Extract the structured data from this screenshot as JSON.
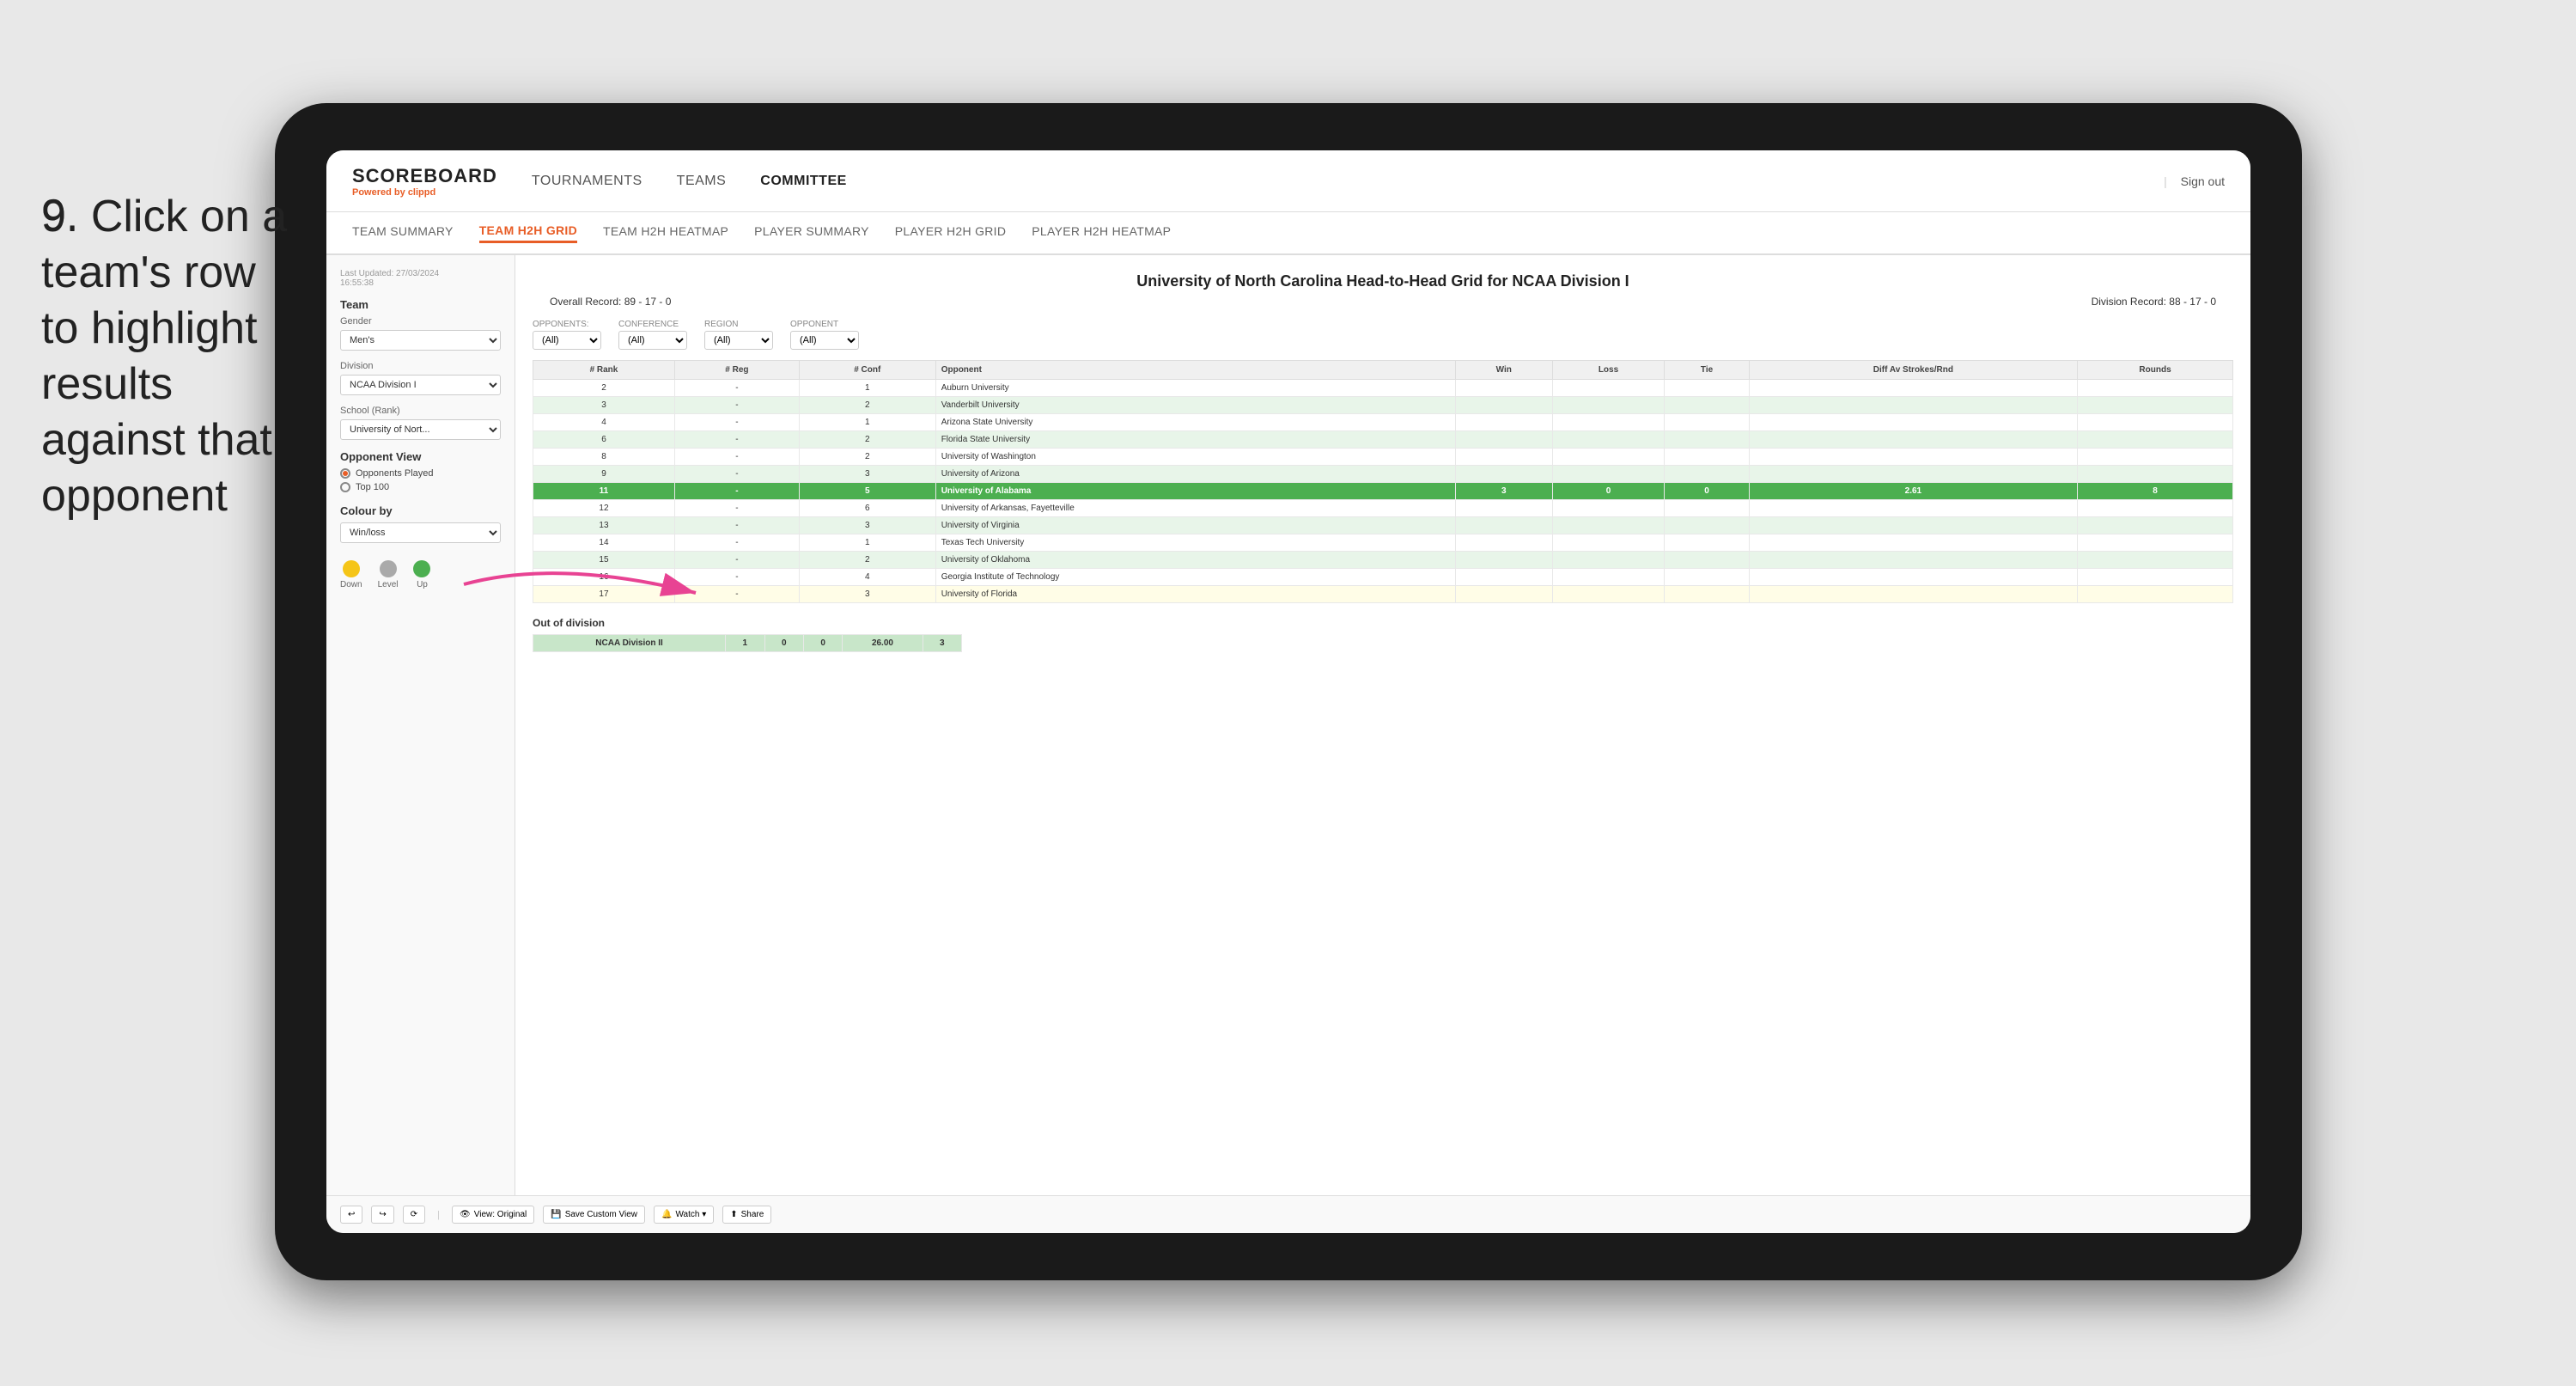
{
  "instruction": {
    "step": "9.",
    "text": "Click on a team's row to highlight results against that opponent"
  },
  "nav": {
    "logo": "SCOREBOARD",
    "powered_by": "Powered by",
    "brand": "clippd",
    "links": [
      "TOURNAMENTS",
      "TEAMS",
      "COMMITTEE"
    ],
    "sign_out": "Sign out"
  },
  "sub_nav": {
    "links": [
      "TEAM SUMMARY",
      "TEAM H2H GRID",
      "TEAM H2H HEATMAP",
      "PLAYER SUMMARY",
      "PLAYER H2H GRID",
      "PLAYER H2H HEATMAP"
    ],
    "active": "TEAM H2H GRID"
  },
  "sidebar": {
    "last_updated_label": "Last Updated: 27/03/2024",
    "time": "16:55:38",
    "team_label": "Team",
    "gender_label": "Gender",
    "gender_value": "Men's",
    "division_label": "Division",
    "division_value": "NCAA Division I",
    "school_label": "School (Rank)",
    "school_value": "University of Nort...",
    "opponent_view_label": "Opponent View",
    "opponents_played": "Opponents Played",
    "top_100": "Top 100",
    "colour_by_label": "Colour by",
    "colour_by_value": "Win/loss",
    "legend": {
      "down": "Down",
      "level": "Level",
      "up": "Up"
    }
  },
  "grid": {
    "title": "University of North Carolina Head-to-Head Grid for NCAA Division I",
    "overall_record_label": "Overall Record:",
    "overall_record": "89 - 17 - 0",
    "division_record_label": "Division Record:",
    "division_record": "88 - 17 - 0",
    "opponents_label": "Opponents:",
    "opponents_value": "(All)",
    "conference_label": "Conference",
    "conference_value": "(All)",
    "region_label": "Region",
    "region_value": "(All)",
    "opponent_label": "Opponent",
    "opponent_value": "(All)",
    "columns": {
      "rank": "# Rank",
      "reg": "# Reg",
      "conf": "# Conf",
      "opponent": "Opponent",
      "win": "Win",
      "loss": "Loss",
      "tie": "Tie",
      "diff_av": "Diff Av Strokes/Rnd",
      "rounds": "Rounds"
    },
    "rows": [
      {
        "rank": "2",
        "reg": "-",
        "conf": "1",
        "opponent": "Auburn University",
        "win": "",
        "loss": "",
        "tie": "",
        "diff": "",
        "rounds": "",
        "style": "normal"
      },
      {
        "rank": "3",
        "reg": "-",
        "conf": "2",
        "opponent": "Vanderbilt University",
        "win": "",
        "loss": "",
        "tie": "",
        "diff": "",
        "rounds": "",
        "style": "light-green"
      },
      {
        "rank": "4",
        "reg": "-",
        "conf": "1",
        "opponent": "Arizona State University",
        "win": "",
        "loss": "",
        "tie": "",
        "diff": "",
        "rounds": "",
        "style": "normal"
      },
      {
        "rank": "6",
        "reg": "-",
        "conf": "2",
        "opponent": "Florida State University",
        "win": "",
        "loss": "",
        "tie": "",
        "diff": "",
        "rounds": "",
        "style": "light-green"
      },
      {
        "rank": "8",
        "reg": "-",
        "conf": "2",
        "opponent": "University of Washington",
        "win": "",
        "loss": "",
        "tie": "",
        "diff": "",
        "rounds": "",
        "style": "normal"
      },
      {
        "rank": "9",
        "reg": "-",
        "conf": "3",
        "opponent": "University of Arizona",
        "win": "",
        "loss": "",
        "tie": "",
        "diff": "",
        "rounds": "",
        "style": "light-green"
      },
      {
        "rank": "11",
        "reg": "-",
        "conf": "5",
        "opponent": "University of Alabama",
        "win": "3",
        "loss": "0",
        "tie": "0",
        "diff": "2.61",
        "rounds": "8",
        "style": "highlighted"
      },
      {
        "rank": "12",
        "reg": "-",
        "conf": "6",
        "opponent": "University of Arkansas, Fayetteville",
        "win": "",
        "loss": "",
        "tie": "",
        "diff": "",
        "rounds": "",
        "style": "normal"
      },
      {
        "rank": "13",
        "reg": "-",
        "conf": "3",
        "opponent": "University of Virginia",
        "win": "",
        "loss": "",
        "tie": "",
        "diff": "",
        "rounds": "",
        "style": "light-green"
      },
      {
        "rank": "14",
        "reg": "-",
        "conf": "1",
        "opponent": "Texas Tech University",
        "win": "",
        "loss": "",
        "tie": "",
        "diff": "",
        "rounds": "",
        "style": "normal"
      },
      {
        "rank": "15",
        "reg": "-",
        "conf": "2",
        "opponent": "University of Oklahoma",
        "win": "",
        "loss": "",
        "tie": "",
        "diff": "",
        "rounds": "",
        "style": "light-green"
      },
      {
        "rank": "16",
        "reg": "-",
        "conf": "4",
        "opponent": "Georgia Institute of Technology",
        "win": "",
        "loss": "",
        "tie": "",
        "diff": "",
        "rounds": "",
        "style": "normal"
      },
      {
        "rank": "17",
        "reg": "-",
        "conf": "3",
        "opponent": "University of Florida",
        "win": "",
        "loss": "",
        "tie": "",
        "diff": "",
        "rounds": "",
        "style": "light-yellow"
      }
    ],
    "out_of_division_label": "Out of division",
    "out_of_division_row": {
      "label": "NCAA Division II",
      "win": "1",
      "loss": "0",
      "tie": "0",
      "diff": "26.00",
      "rounds": "3"
    }
  },
  "toolbar": {
    "undo": "↩",
    "redo": "↪",
    "reset": "⟳",
    "view_original": "View: Original",
    "save_custom": "Save Custom View",
    "watch": "Watch ▾",
    "share": "Share"
  }
}
